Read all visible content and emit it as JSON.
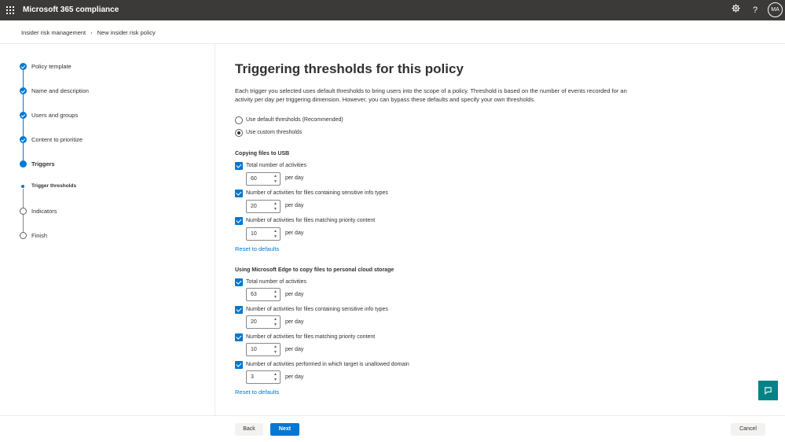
{
  "header": {
    "app_title": "Microsoft 365 compliance",
    "avatar_initials": "MA"
  },
  "breadcrumb": {
    "items": [
      "Insider risk management",
      "New insider risk policy"
    ]
  },
  "wizard": {
    "steps": [
      {
        "label": "Policy template",
        "state": "done"
      },
      {
        "label": "Name and description",
        "state": "done"
      },
      {
        "label": "Users and groups",
        "state": "done"
      },
      {
        "label": "Content to prioritize",
        "state": "done"
      },
      {
        "label": "Triggers",
        "state": "current"
      },
      {
        "label": "Trigger thresholds",
        "state": "current-sub"
      },
      {
        "label": "Indicators",
        "state": "todo"
      },
      {
        "label": "Finish",
        "state": "todo"
      }
    ]
  },
  "main": {
    "title": "Triggering thresholds for this policy",
    "description": "Each trigger you selected uses default thresholds to bring users into the scope of a policy. Threshold is based on the number of events recorded for an activity per day per triggering dimension. However, you can bypass these defaults and specify your own thresholds.",
    "threshold_options": [
      {
        "label": "Use default thresholds (Recommended)",
        "selected": false
      },
      {
        "label": "Use custom thresholds",
        "selected": true
      }
    ],
    "per_day": "per day",
    "reset_label": "Reset to defaults",
    "sections": [
      {
        "title": "Copying files to USB",
        "items": [
          {
            "label": "Total number of activities",
            "checked": true,
            "value": "60"
          },
          {
            "label": "Number of activities for files containing sensitive info types",
            "checked": true,
            "value": "20"
          },
          {
            "label": "Number of activities for files matching priority content",
            "checked": true,
            "value": "10"
          }
        ]
      },
      {
        "title": "Using Microsoft Edge to copy files to personal cloud storage",
        "items": [
          {
            "label": "Total number of activities",
            "checked": true,
            "value": "63"
          },
          {
            "label": "Number of activities for files containing sensitive info types",
            "checked": true,
            "value": "20"
          },
          {
            "label": "Number of activities for files matching priority content",
            "checked": true,
            "value": "10"
          },
          {
            "label": "Number of activities performed in which target is unallowed domain",
            "checked": true,
            "value": "3"
          }
        ]
      }
    ]
  },
  "footer": {
    "back_label": "Back",
    "next_label": "Next",
    "cancel_label": "Cancel"
  },
  "colors": {
    "accent": "#0078d4",
    "header_bg": "#3b3a39",
    "fab": "#038387"
  },
  "icons": {
    "waffle": "app-launcher-icon",
    "settings": "gear-icon",
    "help": "help-icon",
    "fab": "feedback-icon"
  }
}
